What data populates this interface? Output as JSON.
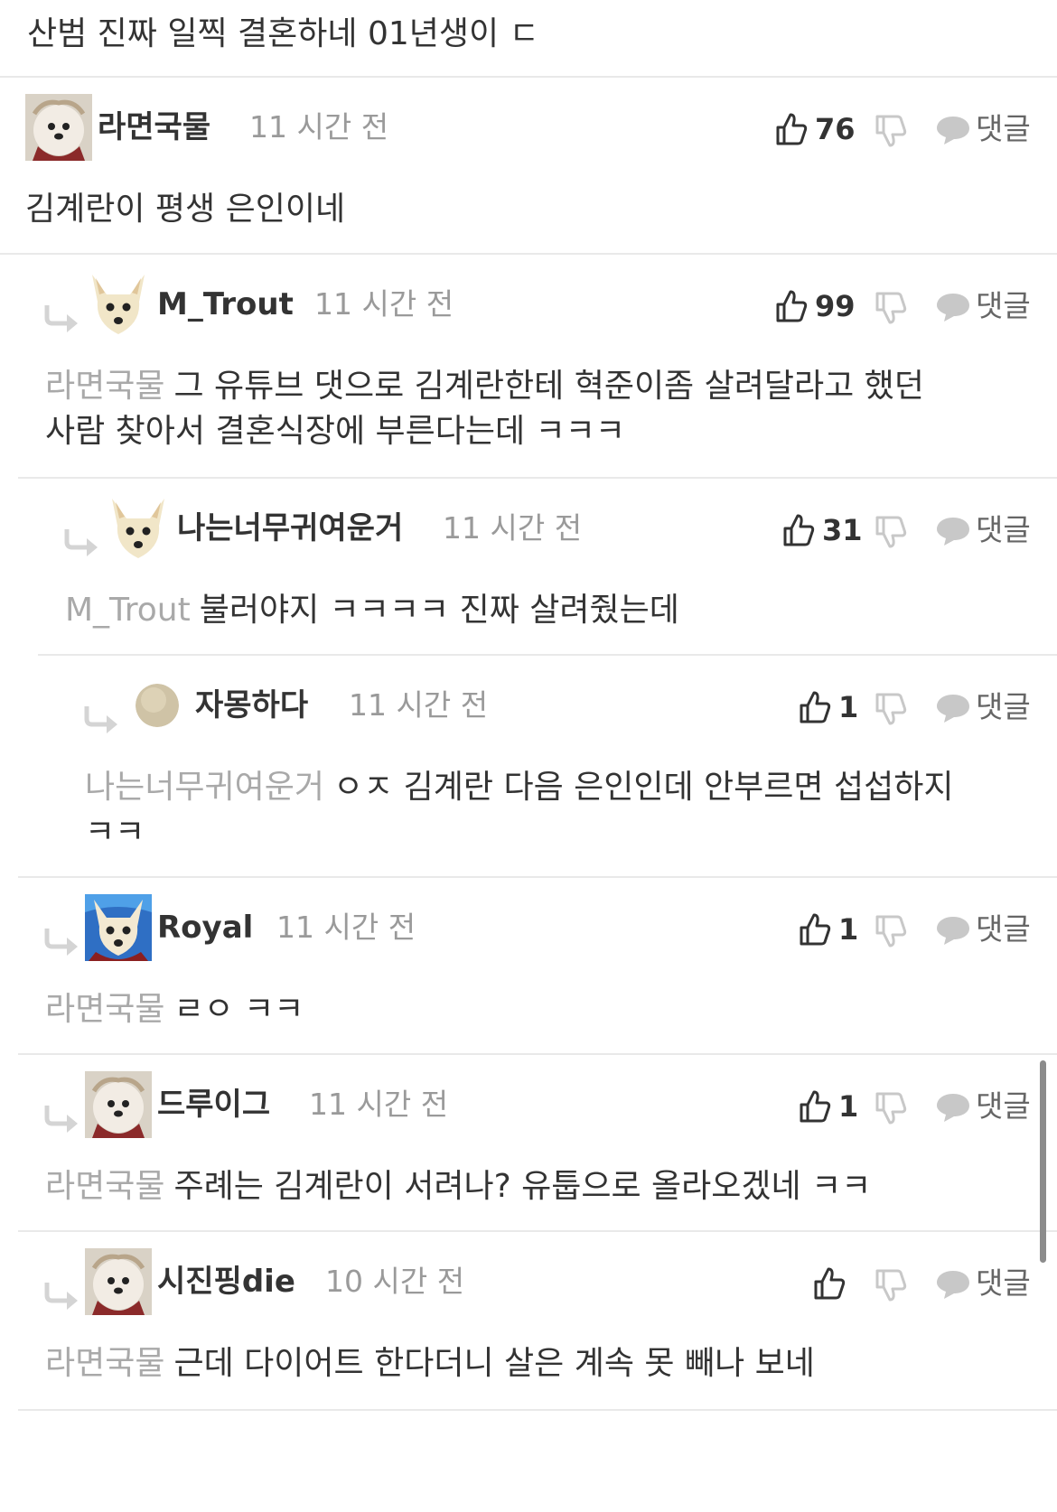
{
  "post_body": "산범 진짜 일찍 결혼하네 01년생이 ㄷ",
  "reply_label": "댓글",
  "comments": [
    {
      "nickname": "라면국물",
      "time": "11 시간 전",
      "likes": "76",
      "mention": "",
      "body": "김계란이 평생 은인이네"
    },
    {
      "nickname": "M_Trout",
      "time": "11 시간 전",
      "likes": "99",
      "mention": "라면국물",
      "body_line1": "그 유튜브 댓으로 김계란한테 혁준이좀 살려달라고 했던",
      "body_line2": "사람 찾아서 결혼식장에 부른다는데 ㅋㅋㅋ"
    },
    {
      "nickname": "나는너무귀여운거",
      "time": "11 시간 전",
      "likes": "31",
      "mention": "M_Trout",
      "body": "불러야지 ㅋㅋㅋㅋ 진짜 살려줬는데"
    },
    {
      "nickname": "자몽하다",
      "time": "11 시간 전",
      "likes": "1",
      "mention": "나는너무귀여운거",
      "body_line1": "ㅇㅈ 김계란 다음 은인인데 안부르면 섭섭하지",
      "body_line2": "ㅋㅋ"
    },
    {
      "nickname": "Royal",
      "time": "11 시간 전",
      "likes": "1",
      "mention": "라면국물",
      "body": "ㄹㅇ ㅋㅋ"
    },
    {
      "nickname": "드루이그",
      "time": "11 시간 전",
      "likes": "1",
      "mention": "라면국물",
      "body": "주례는 김계란이 서려나? 유툽으로 올라오겠네 ㅋㅋ"
    },
    {
      "nickname": "시진핑die",
      "time": "10 시간 전",
      "likes": "",
      "mention": "라면국물",
      "body": "근데 다이어트 한다더니 살은 계속 못 빼나 보네"
    }
  ],
  "icons": {
    "like": "thumbs-up-icon",
    "dislike": "thumbs-down-icon",
    "reply": "speech-bubble-icon",
    "reply_arrow": "reply-arrow-icon"
  },
  "colors": {
    "text": "#333333",
    "muted": "#9a9a9a",
    "mention": "#a9a9a9",
    "icon_gray": "#c8c8c8",
    "divider": "#e9e9e9"
  }
}
